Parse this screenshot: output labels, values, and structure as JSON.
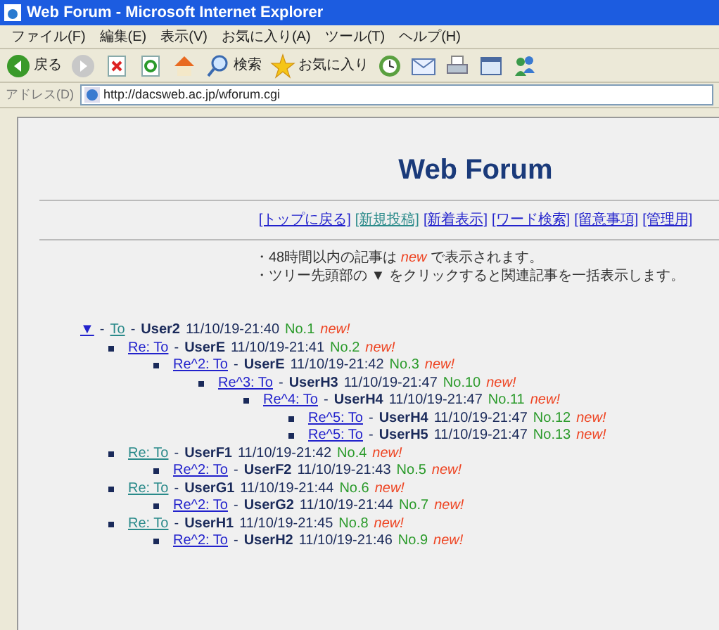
{
  "window": {
    "title": "Web Forum - Microsoft Internet Explorer"
  },
  "menu": [
    "ファイル(F)",
    "編集(E)",
    "表示(V)",
    "お気に入り(A)",
    "ツール(T)",
    "ヘルプ(H)"
  ],
  "toolbar": [
    {
      "kind": "back",
      "label": "戻る"
    },
    {
      "kind": "forward"
    },
    {
      "kind": "stop"
    },
    {
      "kind": "refresh"
    },
    {
      "kind": "home"
    },
    {
      "kind": "search",
      "label": "検索"
    },
    {
      "kind": "favorites",
      "label": "お気に入り"
    },
    {
      "kind": "history"
    },
    {
      "kind": "mail"
    },
    {
      "kind": "print"
    },
    {
      "kind": "edit"
    },
    {
      "kind": "messenger"
    }
  ],
  "address": {
    "label": "アドレス(D)",
    "value": "http://dacsweb.ac.jp/wforum.cgi"
  },
  "page": {
    "title": "Web Forum",
    "nav": [
      {
        "label": "[トップに戻る]",
        "visited": false
      },
      {
        "label": "[新規投稿]",
        "visited": true
      },
      {
        "label": "[新着表示]",
        "visited": false
      },
      {
        "label": "[ワード検索]",
        "visited": false
      },
      {
        "label": "[留意事項]",
        "visited": false
      },
      {
        "label": "[管理用]",
        "visited": false
      }
    ],
    "notes": [
      {
        "before": "・48時間以内の記事は ",
        "mark": "new",
        "after": " で表示されます。"
      },
      {
        "before": "・ツリー先頭部の ▼ をクリックすると関連記事を一括表示します。"
      }
    ],
    "tree": {
      "expand": "▼",
      "expand_sep": "-",
      "subject": "To",
      "visited": true,
      "sep": "-",
      "user": "User2",
      "date": "11/10/19-21:40",
      "no": "No.1",
      "new": "new!",
      "children": [
        {
          "subject": "Re: To",
          "visited": false,
          "sep": "-",
          "user": "UserE",
          "date": "11/10/19-21:41",
          "no": "No.2",
          "new": "new!",
          "children": [
            {
              "subject": "Re^2: To",
              "visited": false,
              "sep": "-",
              "user": "UserE",
              "date": "11/10/19-21:42",
              "no": "No.3",
              "new": "new!",
              "children": [
                {
                  "subject": "Re^3: To",
                  "visited": false,
                  "sep": "-",
                  "user": "UserH3",
                  "date": "11/10/19-21:47",
                  "no": "No.10",
                  "new": "new!",
                  "children": [
                    {
                      "subject": "Re^4: To",
                      "visited": false,
                      "sep": "-",
                      "user": "UserH4",
                      "date": "11/10/19-21:47",
                      "no": "No.11",
                      "new": "new!",
                      "children": [
                        {
                          "subject": "Re^5: To",
                          "visited": false,
                          "sep": "-",
                          "user": "UserH4",
                          "date": "11/10/19-21:47",
                          "no": "No.12",
                          "new": "new!"
                        },
                        {
                          "subject": "Re^5: To",
                          "visited": false,
                          "sep": "-",
                          "user": "UserH5",
                          "date": "11/10/19-21:47",
                          "no": "No.13",
                          "new": "new!"
                        }
                      ]
                    }
                  ]
                }
              ]
            }
          ]
        },
        {
          "subject": "Re: To",
          "visited": true,
          "sep": "-",
          "user": "UserF1",
          "date": "11/10/19-21:42",
          "no": "No.4",
          "new": "new!",
          "children": [
            {
              "subject": "Re^2: To",
              "visited": false,
              "sep": "-",
              "user": "UserF2",
              "date": "11/10/19-21:43",
              "no": "No.5",
              "new": "new!"
            }
          ]
        },
        {
          "subject": "Re: To",
          "visited": true,
          "sep": "-",
          "user": "UserG1",
          "date": "11/10/19-21:44",
          "no": "No.6",
          "new": "new!",
          "children": [
            {
              "subject": "Re^2: To",
              "visited": false,
              "sep": "-",
              "user": "UserG2",
              "date": "11/10/19-21:44",
              "no": "No.7",
              "new": "new!"
            }
          ]
        },
        {
          "subject": "Re: To",
          "visited": true,
          "sep": "-",
          "user": "UserH1",
          "date": "11/10/19-21:45",
          "no": "No.8",
          "new": "new!",
          "children": [
            {
              "subject": "Re^2: To",
              "visited": false,
              "sep": "-",
              "user": "UserH2",
              "date": "11/10/19-21:46",
              "no": "No.9",
              "new": "new!"
            }
          ]
        }
      ]
    }
  }
}
